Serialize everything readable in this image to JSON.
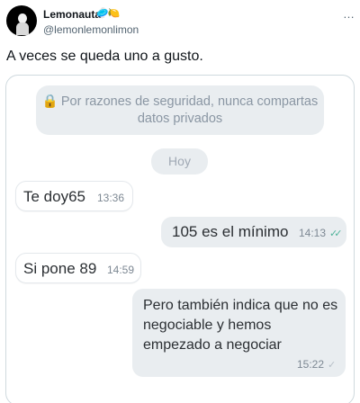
{
  "tweet": {
    "display_name": "Lemonauta",
    "name_emoji": "🥏🍋",
    "handle": "@lemonlemonlimon",
    "more_icon": "…",
    "text": "A veces se queda uno a gusto."
  },
  "chat": {
    "security_notice": {
      "lock_icon": "🔒",
      "text": "Por razones de seguridad, nunca compartas datos privados"
    },
    "date_chip": "Hoy",
    "messages": [
      {
        "direction": "incoming",
        "text": "Te doy65",
        "time": "13:36"
      },
      {
        "direction": "outgoing",
        "text": "105 es el mínimo",
        "time": "14:13",
        "status": "read"
      },
      {
        "direction": "incoming",
        "text": "Si pone 89",
        "time": "14:59"
      },
      {
        "direction": "outgoing",
        "text": "Pero también indica que no es negociable y hemos empezado a negociar",
        "time": "15:22",
        "status": "sent"
      }
    ]
  },
  "colors": {
    "chip_background": "#e9edf0",
    "read_check": "#4fb39a",
    "lock": "#e6a23c"
  }
}
